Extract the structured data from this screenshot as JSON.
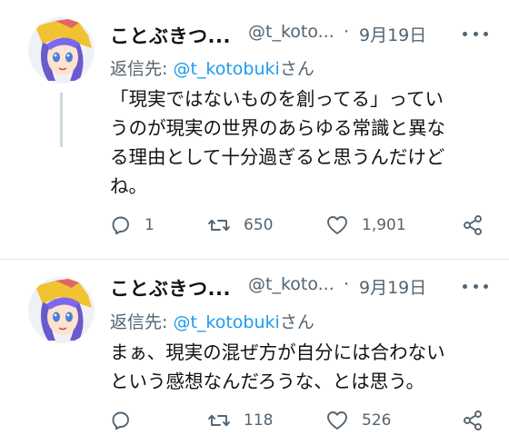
{
  "colors": {
    "link": "#1d9bf0",
    "secondary": "#536471",
    "text": "#0f1419",
    "divider": "#e1e8ed"
  },
  "tweets": [
    {
      "display_name": "ことぶきつ...",
      "handle": "@t_koto...",
      "separator": "·",
      "date": "9月19日",
      "reply_prefix": "返信先: ",
      "reply_to": "@t_kotobuki",
      "reply_suffix": "さん",
      "text": "「現実ではないものを創ってる」ってい\nうのが現実の世界のあらゆる常識と異な\nる理由として十分過ぎると思うんだけど\nね。",
      "counts": {
        "replies": "1",
        "retweets": "650",
        "likes": "1,901"
      },
      "icons": [
        "avatar-image",
        "more-icon",
        "reply-icon",
        "retweet-icon",
        "like-icon",
        "share-icon"
      ]
    },
    {
      "display_name": "ことぶきつ...",
      "handle": "@t_koto...",
      "separator": "·",
      "date": "9月19日",
      "reply_prefix": "返信先: ",
      "reply_to": "@t_kotobuki",
      "reply_suffix": "さん",
      "text": "まぁ、現実の混ぜ方が自分には合わない\nという感想なんだろうな、とは思う。",
      "counts": {
        "replies": "",
        "retweets": "118",
        "likes": "526"
      },
      "icons": [
        "avatar-image",
        "more-icon",
        "reply-icon",
        "retweet-icon",
        "like-icon",
        "share-icon"
      ]
    }
  ]
}
